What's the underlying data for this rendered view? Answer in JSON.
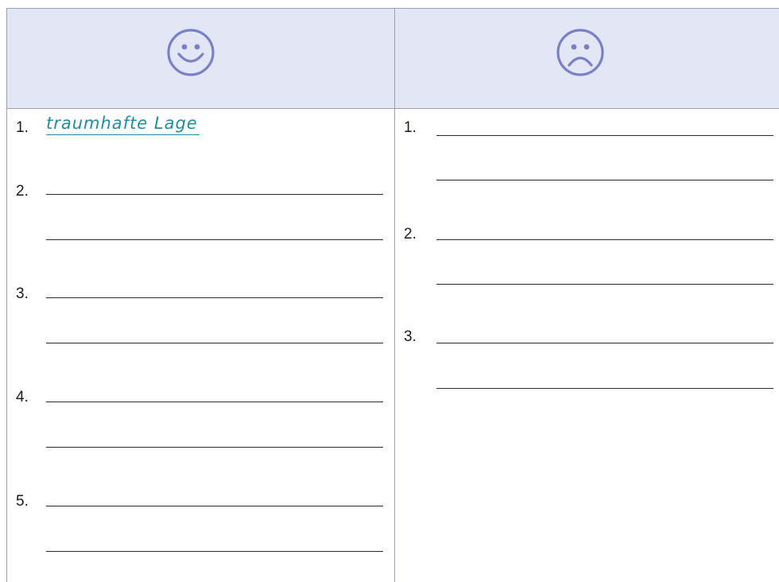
{
  "header": {
    "left_icon": "smiley-face-icon",
    "right_icon": "sad-face-icon",
    "icon_color": "#7a80c8",
    "header_bg": "#e3e6f5"
  },
  "left_column": {
    "items": [
      {
        "number": "1.",
        "answer": "traumhafte Lage"
      },
      {
        "number": "2."
      },
      {
        "number": "3."
      },
      {
        "number": "4."
      },
      {
        "number": "5."
      }
    ],
    "answer_color": "#1f8e9e"
  },
  "right_column": {
    "items": [
      {
        "number": "1."
      },
      {
        "number": "2."
      },
      {
        "number": "3."
      }
    ]
  }
}
